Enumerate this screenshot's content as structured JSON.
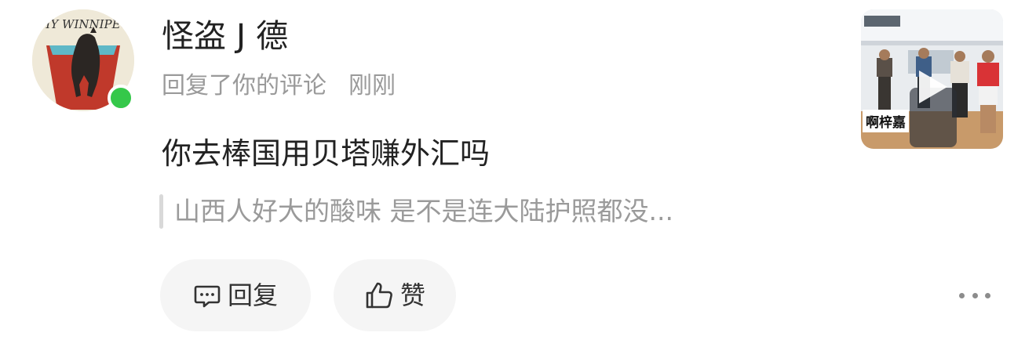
{
  "user": {
    "name": "怪盗 J 德",
    "avatar_icon": "horse-cup-avatar",
    "online_color": "#35c84a"
  },
  "notification": {
    "action": "回复了你的评论",
    "time": "刚刚"
  },
  "comment": {
    "text": "你去棒国用贝塔赚外汇吗",
    "quoted": "山西人好大的酸味 是不是连大陆护照都没..."
  },
  "actions": {
    "reply_label": "回复",
    "like_label": "赞"
  },
  "video_thumbnail": {
    "caption": "啊梓嘉",
    "play_icon": "play-icon"
  },
  "more_icon": "more-dots-icon"
}
